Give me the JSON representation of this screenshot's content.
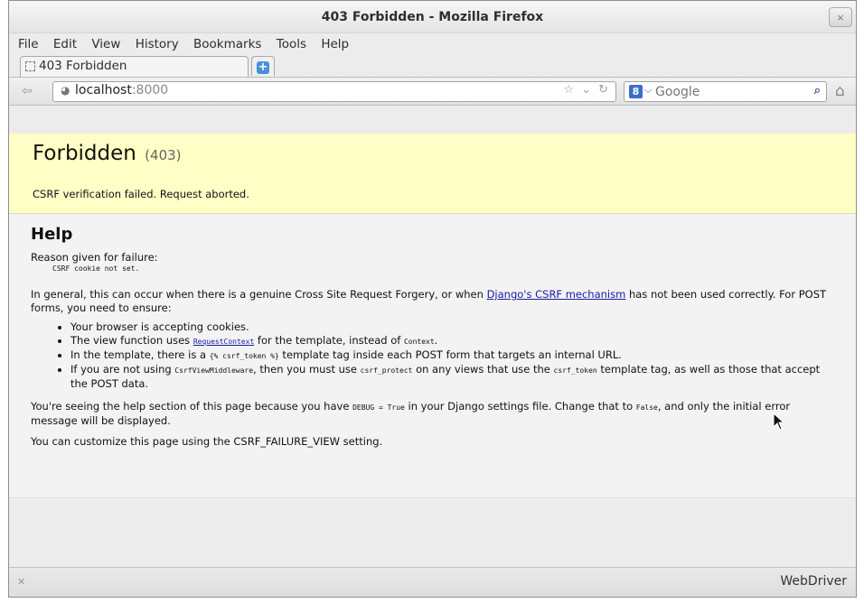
{
  "window": {
    "title": "403 Forbidden - Mozilla Firefox",
    "close_glyph": "×"
  },
  "menubar": [
    "File",
    "Edit",
    "View",
    "History",
    "Bookmarks",
    "Tools",
    "Help"
  ],
  "tab": {
    "label": "403 Forbidden",
    "new_tab_glyph": "+"
  },
  "navbar": {
    "back_glyph": "⇦",
    "url_host": "localhost",
    "url_port": ":8000",
    "url_tools": "☆ ⌄ ↻",
    "search_engine_glyph": "8",
    "search_placeholder": "Google",
    "search_go_glyph": "⌕",
    "home_glyph": "⌂"
  },
  "page": {
    "heading": "Forbidden",
    "code": "(403)",
    "message": "CSRF verification failed. Request aborted.",
    "help_heading": "Help",
    "reason_label": "Reason given for failure:",
    "reason_code": "CSRF cookie not set.",
    "general_pre": "In general, this can occur when there is a genuine Cross Site Request Forgery, or when ",
    "general_link": "Django's CSRF mechanism",
    "general_post": " has not been used correctly. For POST forms, you need to ensure:",
    "bullet1": "Your browser is accepting cookies.",
    "bullet2_pre": "The view function uses ",
    "bullet2_link": "RequestContext",
    "bullet2_mid": " for the template, instead of ",
    "bullet2_code": "Context",
    "bullet2_post": ".",
    "bullet3_pre": "In the template, there is a ",
    "bullet3_code": "{% csrf_token %}",
    "bullet3_post": " template tag inside each POST form that targets an internal URL.",
    "bullet4_a": "If you are not using ",
    "bullet4_code1": "CsrfViewMiddleware",
    "bullet4_b": ", then you must use ",
    "bullet4_code2": "csrf_protect",
    "bullet4_c": " on any views that use the ",
    "bullet4_code3": "csrf_token",
    "bullet4_d": " template tag, as well as those that accept the POST data.",
    "debug_pre": "You're seeing the help section of this page because you have ",
    "debug_code1": "DEBUG = True",
    "debug_mid": " in your Django settings file. Change that to ",
    "debug_code2": "False",
    "debug_post": ", and only the initial error message will be displayed.",
    "customize": "You can customize this page using the CSRF_FAILURE_VIEW setting."
  },
  "statusbar": {
    "left_glyph": "✕",
    "right": "WebDriver"
  }
}
